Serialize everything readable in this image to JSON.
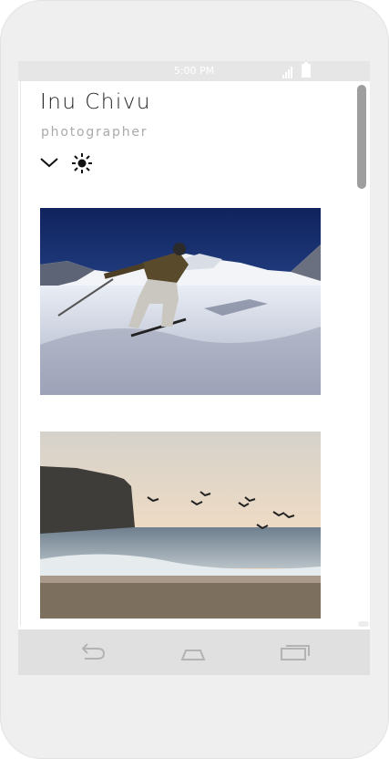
{
  "statusbar": {
    "time": "5:00 PM",
    "signal_icon": "signal-icon",
    "battery_icon": "battery-icon"
  },
  "profile": {
    "name": "Inu Chivu",
    "role": "photographer"
  },
  "actions": [
    {
      "icon": "chevron-down-icon"
    },
    {
      "icon": "sun-icon"
    }
  ],
  "gallery": [
    {
      "subject": "skier on snowy mountain slope"
    },
    {
      "subject": "seagulls over beach at sunset with cliff"
    }
  ],
  "navbar": {
    "back_icon": "back-icon",
    "home_icon": "home-icon",
    "recent_icon": "recent-apps-icon"
  },
  "colors": {
    "frame": "#efefef",
    "bars": "#e0e0e0",
    "title": "#222222",
    "subtitle": "#aaaaaa",
    "scrollbar": "#9e9e9e"
  }
}
